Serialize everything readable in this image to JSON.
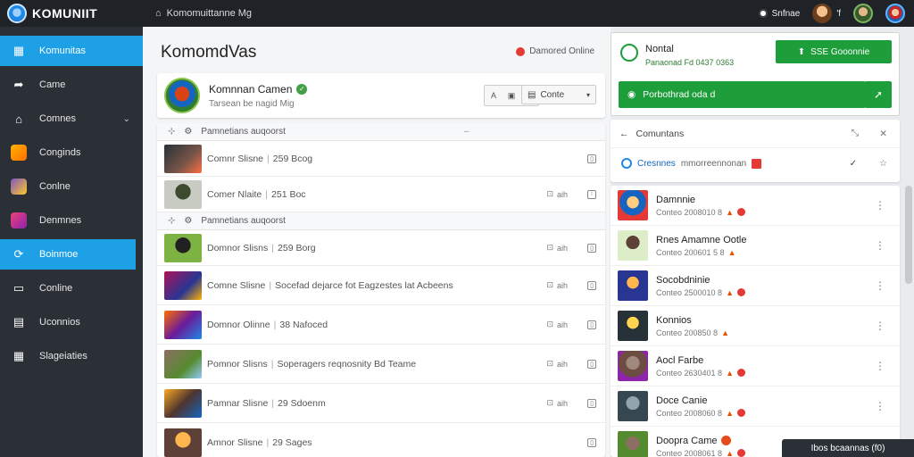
{
  "app": {
    "brand": "KOMUNIIT",
    "title": "Komomuittanne Mg",
    "status_label": "Snfnae",
    "avatar_b_label": "'f"
  },
  "sidebar": {
    "items": [
      {
        "label": "Komunitas",
        "icon": "home-icon"
      },
      {
        "label": "Came",
        "icon": "bookmark-icon"
      },
      {
        "label": "Comnes",
        "icon": "house-icon"
      },
      {
        "label": "Conginds",
        "icon": "game-tile-icon"
      },
      {
        "label": "Conlne",
        "icon": "game-tile-icon"
      },
      {
        "label": "Denmnes",
        "icon": "game-tile-icon"
      },
      {
        "label": "Boinmoe",
        "icon": "sync-icon"
      },
      {
        "label": "Conline",
        "icon": "window-icon"
      },
      {
        "label": "Uconnios",
        "icon": "grid-icon"
      },
      {
        "label": "Slageiaties",
        "icon": "table-icon"
      }
    ]
  },
  "main": {
    "title": "KomomdVas",
    "online_label": "Damored Online",
    "profile": {
      "name": "Komnnan Camen",
      "subtitle": "Tarsean be nagid Mig",
      "select_label": "Conte"
    },
    "groups": [
      {
        "header": "Pamnetians auqoorst",
        "rows": [
          {
            "title": "Comnr Slisne",
            "meta": "259 Bcog",
            "icons": ""
          },
          {
            "title": "Comer Nlaite",
            "meta": "251 Boc",
            "icons": "aih"
          }
        ]
      },
      {
        "header": "Pamnetians auqoorst",
        "rows": [
          {
            "title": "Domnor Slisns",
            "meta": "259 Borg",
            "icons": "aih"
          },
          {
            "title": "Comne Slisne",
            "meta": "Socefad dejarce fot Eagzestes lat Acbeens",
            "icons": "aih"
          },
          {
            "title": "Domnor Olinne",
            "meta": "38 Nafoced",
            "icons": "aih"
          },
          {
            "title": "Pomnor Slisns",
            "meta": "Soperagers reqnosnity Bd Teame",
            "icons": "aih"
          },
          {
            "title": "Pamnar Slisne",
            "meta": "29 Sdoenm",
            "icons": "aih"
          },
          {
            "title": "Amnor Slisne",
            "meta": "29 Sages",
            "icons": ""
          }
        ]
      }
    ]
  },
  "right": {
    "notif": {
      "title": "Nontal",
      "subtitle": "Panaonad Fd 0437 0363",
      "button": "SSE Gooonnie",
      "bar_label": "Porbothrad oda d"
    },
    "communities": {
      "header": "Comuntans",
      "row_name": "Cresnnes",
      "row_sub": "mmorreennonan"
    },
    "list": [
      {
        "name": "Damnnie",
        "sub": "Conteo 2008010 8"
      },
      {
        "name": "Rnes Amamne Ootle",
        "sub": "Conteo 200601 5 8"
      },
      {
        "name": "Socobdninie",
        "sub": "Conteo 2500010 8"
      },
      {
        "name": "Konnios",
        "sub": "Conteo 200850 8"
      },
      {
        "name": "Aocl Farbe",
        "sub": "Conteo 2630401 8"
      },
      {
        "name": "Doce Canie",
        "sub": "Conteo 2008060 8"
      },
      {
        "name": "Doopra Came",
        "sub": "Conteo 2008061 8"
      }
    ],
    "toast": "Ibos bcaannas (f0)"
  }
}
